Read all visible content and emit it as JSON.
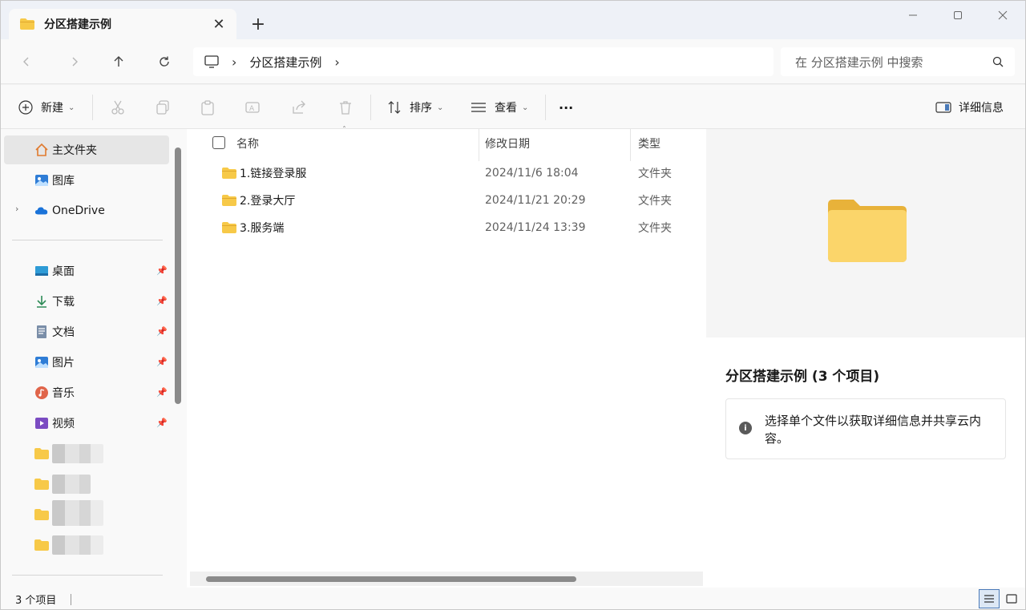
{
  "tab": {
    "title": "分区搭建示例",
    "close": "✕",
    "new_tab": "+"
  },
  "window_controls": {
    "minimize": "—",
    "maximize": "☐",
    "close": "✕"
  },
  "nav": {
    "back": "‹",
    "forward": "›",
    "up": "↑",
    "refresh": "↻"
  },
  "address": {
    "separator": "›",
    "path": "分区搭建示例"
  },
  "search": {
    "placeholder": "在 分区搭建示例 中搜索"
  },
  "commands": {
    "new_label": "新建",
    "sort_label": "排序",
    "view_label": "查看",
    "more_label": "···",
    "details_label": "详细信息"
  },
  "sidebar": {
    "top_items": [
      {
        "label": "主文件夹",
        "icon": "home-icon"
      },
      {
        "label": "图库",
        "icon": "gallery-icon"
      },
      {
        "label": "OneDrive",
        "icon": "onedrive-icon"
      }
    ],
    "pinned_items": [
      {
        "label": "桌面",
        "icon": "desktop-icon"
      },
      {
        "label": "下载",
        "icon": "download-icon"
      },
      {
        "label": "文档",
        "icon": "documents-icon"
      },
      {
        "label": "图片",
        "icon": "pictures-icon"
      },
      {
        "label": "音乐",
        "icon": "music-icon"
      },
      {
        "label": "视频",
        "icon": "videos-icon"
      }
    ],
    "pin_glyph": "📌"
  },
  "table": {
    "columns": {
      "name": "名称",
      "date": "修改日期",
      "type": "类型"
    },
    "rows": [
      {
        "name": "1.链接登录服",
        "date": "2024/11/6 18:04",
        "type": "文件夹"
      },
      {
        "name": "2.登录大厅",
        "date": "2024/11/21 20:29",
        "type": "文件夹"
      },
      {
        "name": "3.服务端",
        "date": "2024/11/24 13:39",
        "type": "文件夹"
      }
    ]
  },
  "details": {
    "title": "分区搭建示例 (3 个项目)",
    "info_icon": "i",
    "info_text": "选择单个文件以获取详细信息并共享云内容。"
  },
  "status": {
    "item_count": "3 个项目"
  },
  "colors": {
    "folder": "#f7c948",
    "folder_dark": "#e0a82e",
    "accent": "#4a7ab8"
  }
}
